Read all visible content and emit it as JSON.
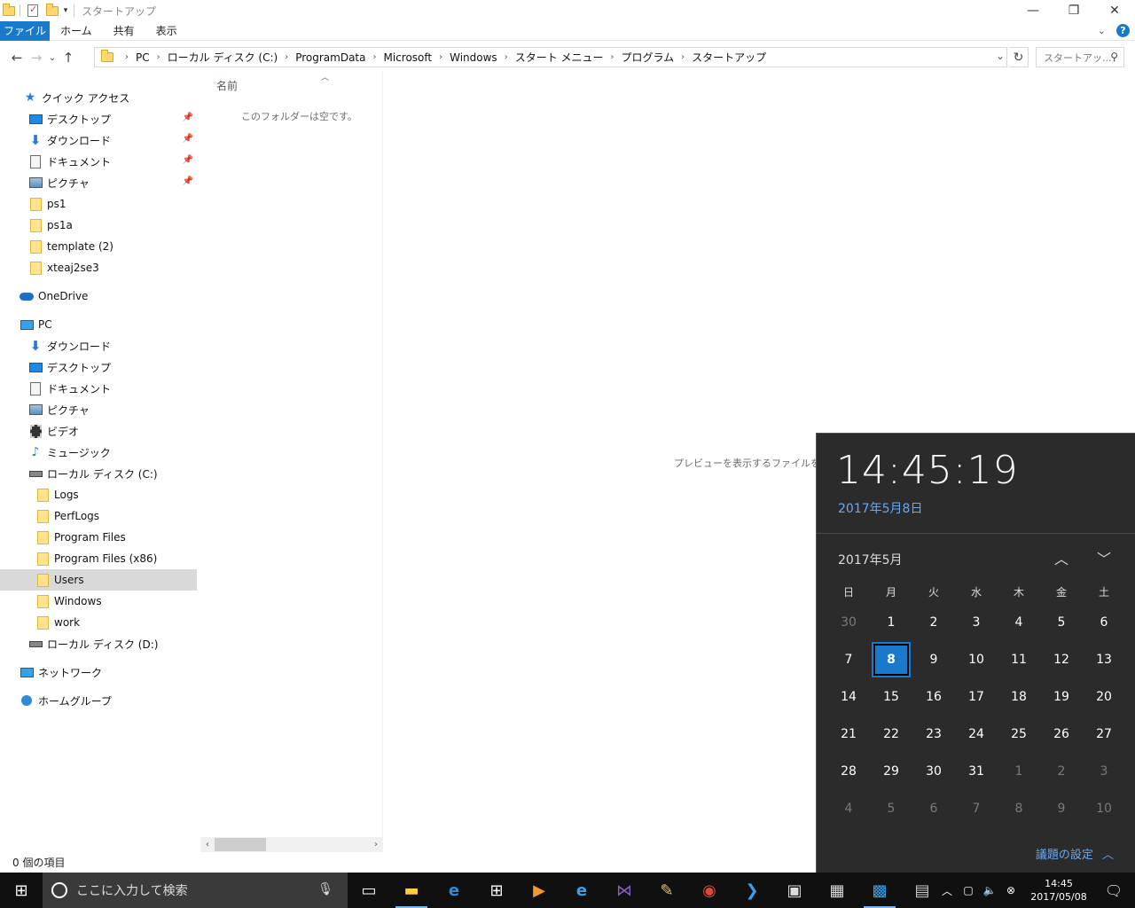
{
  "window": {
    "title": "スタートアップ"
  },
  "ribbon": {
    "tabs": [
      "ファイル",
      "ホーム",
      "共有",
      "表示"
    ]
  },
  "address": {
    "breadcrumbs": [
      "PC",
      "ローカル ディスク (C:)",
      "ProgramData",
      "Microsoft",
      "Windows",
      "スタート メニュー",
      "プログラム",
      "スタートアップ"
    ],
    "search_placeholder": "スタートアッ..."
  },
  "nav": {
    "items": [
      {
        "label": "クイック アクセス",
        "icon": "star-icon",
        "pinned": false
      },
      {
        "label": "デスクトップ",
        "icon": "desktop-icon",
        "pinned": true
      },
      {
        "label": "ダウンロード",
        "icon": "download-icon",
        "pinned": true
      },
      {
        "label": "ドキュメント",
        "icon": "document-icon",
        "pinned": true
      },
      {
        "label": "ピクチャ",
        "icon": "pictures-icon",
        "pinned": true
      },
      {
        "label": "ps1",
        "icon": "folder-icon",
        "pinned": false
      },
      {
        "label": "ps1a",
        "icon": "folder-icon",
        "pinned": false
      },
      {
        "label": "template (2)",
        "icon": "folder-icon",
        "pinned": false
      },
      {
        "label": "xteaj2se3",
        "icon": "folder-icon",
        "pinned": false
      },
      {
        "label": "OneDrive",
        "icon": "onedrive-icon",
        "pinned": false
      },
      {
        "label": "PC",
        "icon": "pc-icon",
        "pinned": false
      },
      {
        "label": "ダウンロード",
        "icon": "download-icon",
        "pinned": false
      },
      {
        "label": "デスクトップ",
        "icon": "desktop-icon",
        "pinned": false
      },
      {
        "label": "ドキュメント",
        "icon": "document-icon",
        "pinned": false
      },
      {
        "label": "ピクチャ",
        "icon": "pictures-icon",
        "pinned": false
      },
      {
        "label": "ビデオ",
        "icon": "video-icon",
        "pinned": false
      },
      {
        "label": "ミュージック",
        "icon": "music-icon",
        "pinned": false
      },
      {
        "label": "ローカル ディスク (C:)",
        "icon": "drive-icon",
        "pinned": false
      },
      {
        "label": "Logs",
        "icon": "folder-icon",
        "pinned": false
      },
      {
        "label": "PerfLogs",
        "icon": "folder-icon",
        "pinned": false
      },
      {
        "label": "Program Files",
        "icon": "folder-icon",
        "pinned": false
      },
      {
        "label": "Program Files (x86)",
        "icon": "folder-icon",
        "pinned": false
      },
      {
        "label": "Users",
        "icon": "folder-icon",
        "pinned": false,
        "selected": true
      },
      {
        "label": "Windows",
        "icon": "folder-icon",
        "pinned": false
      },
      {
        "label": "work",
        "icon": "folder-icon",
        "pinned": false
      },
      {
        "label": "ローカル ディスク (D:)",
        "icon": "drive-icon",
        "pinned": false
      },
      {
        "label": "ネットワーク",
        "icon": "network-icon",
        "pinned": false
      },
      {
        "label": "ホームグループ",
        "icon": "homegroup-icon",
        "pinned": false
      }
    ]
  },
  "content": {
    "column_header": "名前",
    "empty_message": "このフォルダーは空です。",
    "preview_message": "プレビューを表示するファイルを選択"
  },
  "status": {
    "item_count": "0 個の項目"
  },
  "clock_flyout": {
    "time": "14:45:19",
    "date": "2017年5月8日",
    "month_label": "2017年5月",
    "weekdays": [
      "日",
      "月",
      "火",
      "水",
      "木",
      "金",
      "土"
    ],
    "weeks": [
      [
        {
          "d": "30",
          "o": true
        },
        {
          "d": "1"
        },
        {
          "d": "2"
        },
        {
          "d": "3"
        },
        {
          "d": "4"
        },
        {
          "d": "5"
        },
        {
          "d": "6"
        }
      ],
      [
        {
          "d": "7"
        },
        {
          "d": "8",
          "today": true
        },
        {
          "d": "9"
        },
        {
          "d": "10"
        },
        {
          "d": "11"
        },
        {
          "d": "12"
        },
        {
          "d": "13"
        }
      ],
      [
        {
          "d": "14"
        },
        {
          "d": "15"
        },
        {
          "d": "16"
        },
        {
          "d": "17"
        },
        {
          "d": "18"
        },
        {
          "d": "19"
        },
        {
          "d": "20"
        }
      ],
      [
        {
          "d": "21"
        },
        {
          "d": "22"
        },
        {
          "d": "23"
        },
        {
          "d": "24"
        },
        {
          "d": "25"
        },
        {
          "d": "26"
        },
        {
          "d": "27"
        }
      ],
      [
        {
          "d": "28"
        },
        {
          "d": "29"
        },
        {
          "d": "30"
        },
        {
          "d": "31"
        },
        {
          "d": "1",
          "o": true
        },
        {
          "d": "2",
          "o": true
        },
        {
          "d": "3",
          "o": true
        }
      ],
      [
        {
          "d": "4",
          "o": true
        },
        {
          "d": "5",
          "o": true
        },
        {
          "d": "6",
          "o": true
        },
        {
          "d": "7",
          "o": true
        },
        {
          "d": "8",
          "o": true
        },
        {
          "d": "9",
          "o": true
        },
        {
          "d": "10",
          "o": true
        }
      ]
    ],
    "agenda_label": "議題の設定"
  },
  "taskbar": {
    "search_placeholder": "ここに入力して検索",
    "apps": [
      "task-view-icon",
      "file-explorer-icon",
      "edge-icon",
      "store-icon",
      "media-player-icon",
      "internet-explorer-icon",
      "visual-studio-icon",
      "paint-icon",
      "chrome-icon",
      "powershell-icon",
      "remote-desktop-icon",
      "calculator-icon",
      "network-admin-icon",
      "monitor-icon"
    ],
    "clock_time": "14:45",
    "clock_date": "2017/05/08"
  },
  "colors": {
    "accent": "#1979ca",
    "flyout_bg": "#2b2b2b",
    "link_blue": "#67a8f5",
    "taskbar_bg": "#101010"
  }
}
